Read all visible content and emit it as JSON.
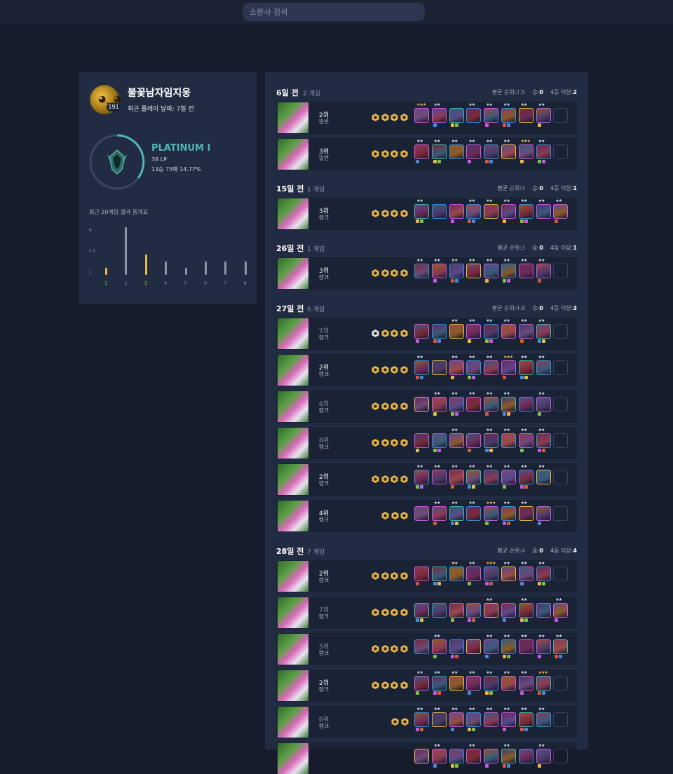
{
  "search": {
    "placeholder": "소환사 검색"
  },
  "profile": {
    "name": "불꽃남자임지웅",
    "level": "191",
    "last_played": "최근 플레이 날짜: 7일 전",
    "tier": "PLATINUM I",
    "lp": "38 LP",
    "record": "13승 75패 14.77%"
  },
  "stats_chart": {
    "title": "최근 20게임 결과 통계표",
    "y_ticks": [
      "6",
      "3.5",
      "1"
    ],
    "chart_data": {
      "type": "bar",
      "categories": [
        "1",
        "2",
        "3",
        "4",
        "5",
        "6",
        "7",
        "8"
      ],
      "values": [
        1,
        7,
        3,
        2,
        1,
        2,
        2,
        2
      ],
      "ylim": [
        0,
        7
      ],
      "highlight_color": "#e8b84a",
      "base_color": "#8a93a8",
      "grid": false
    }
  },
  "groups": [
    {
      "date": "6일 전",
      "count": "2 게임",
      "avg_label": "평균 순위:",
      "avg": "2.5",
      "win_label": "승:",
      "wins": "0",
      "top4_label": "4등 이상:",
      "top4": "2"
    },
    {
      "date": "15일 전",
      "count": "1 게임",
      "avg_label": "평균 순위:",
      "avg": "3",
      "win_label": "승:",
      "wins": "0",
      "top4_label": "4등 이상:",
      "top4": "1"
    },
    {
      "date": "26일 전",
      "count": "1 게임",
      "avg_label": "평균 순위:",
      "avg": "3",
      "win_label": "승:",
      "wins": "0",
      "top4_label": "4등 이상:",
      "top4": "1"
    },
    {
      "date": "27일 전",
      "count": "6 게임",
      "avg_label": "평균 순위:",
      "avg": "4.8",
      "win_label": "승:",
      "wins": "0",
      "top4_label": "4등 이상:",
      "top4": "3"
    },
    {
      "date": "28일 전",
      "count": "7 게임",
      "avg_label": "평균 순위:",
      "avg": "4",
      "win_label": "승:",
      "wins": "0",
      "top4_label": "4등 이상:",
      "top4": "4"
    }
  ],
  "matches": [
    {
      "placement": "2위",
      "mode": "일반",
      "traits": 4,
      "units": 8,
      "stars": [
        "3",
        "2",
        "",
        "2",
        "2",
        "2",
        "2",
        "2"
      ]
    },
    {
      "placement": "3위",
      "mode": "일반",
      "traits": 4,
      "units": 8,
      "stars": [
        "2",
        "2",
        "2",
        "2",
        "2",
        "2",
        "3",
        "2"
      ]
    },
    {
      "placement": "3위",
      "mode": "랭크",
      "traits": 4,
      "units": 9,
      "stars": [
        "2",
        "",
        "",
        "2",
        "2",
        "2",
        "2",
        "2",
        "2"
      ]
    },
    {
      "placement": "3위",
      "mode": "랭크",
      "traits": 4,
      "units": 8,
      "stars": [
        "2",
        "2",
        "2",
        "2",
        "2",
        "2",
        "2",
        "2"
      ]
    },
    {
      "placement": "7위",
      "mode": "랭크",
      "traits": 4,
      "units": 8,
      "stars": [
        "",
        "",
        "2",
        "2",
        "2",
        "2",
        "2",
        "2"
      ]
    },
    {
      "placement": "2위",
      "mode": "랭크",
      "traits": 4,
      "units": 8,
      "stars": [
        "2",
        "",
        "2",
        "2",
        "2",
        "3",
        "2",
        "2"
      ]
    },
    {
      "placement": "6위",
      "mode": "랭크",
      "traits": 4,
      "units": 8,
      "stars": [
        "",
        "2",
        "2",
        "2",
        "2",
        "2",
        "",
        "2"
      ]
    },
    {
      "placement": "8위",
      "mode": "랭크",
      "traits": 4,
      "units": 8,
      "stars": [
        "",
        "",
        "2",
        "",
        "2",
        "2",
        "2",
        "2"
      ]
    },
    {
      "placement": "2위",
      "mode": "랭크",
      "traits": 4,
      "units": 8,
      "stars": [
        "2",
        "2",
        "2",
        "2",
        "2",
        "2",
        "2",
        "2"
      ]
    },
    {
      "placement": "4위",
      "mode": "랭크",
      "traits": 3,
      "units": 8,
      "stars": [
        "",
        "2",
        "2",
        "2",
        "3",
        "2",
        "2",
        ""
      ]
    },
    {
      "placement": "2위",
      "mode": "랭크",
      "traits": 4,
      "units": 8,
      "stars": [
        "",
        "",
        "2",
        "2",
        "3",
        "2",
        "2",
        "2"
      ]
    },
    {
      "placement": "7위",
      "mode": "랭크",
      "traits": 4,
      "units": 9,
      "stars": [
        "",
        "",
        "",
        "",
        "2",
        "",
        "2",
        "",
        "2"
      ]
    },
    {
      "placement": "5위",
      "mode": "랭크",
      "traits": 4,
      "units": 9,
      "stars": [
        "",
        "2",
        "",
        "",
        "2",
        "2",
        "2",
        "2",
        "2"
      ]
    },
    {
      "placement": "2위",
      "mode": "랭크",
      "traits": 4,
      "units": 8,
      "stars": [
        "2",
        "2",
        "2",
        "2",
        "2",
        "2",
        "2",
        "3"
      ]
    },
    {
      "placement": "6위",
      "mode": "랭크",
      "traits": 2,
      "units": 8,
      "stars": [
        "2",
        "2",
        "2",
        "2",
        "2",
        "2",
        "2",
        "2"
      ]
    },
    {
      "placement": "",
      "mode": "",
      "traits": 0,
      "units": 8,
      "stars": [
        "",
        "2",
        "",
        "2",
        "",
        "2",
        "",
        "2"
      ]
    }
  ]
}
